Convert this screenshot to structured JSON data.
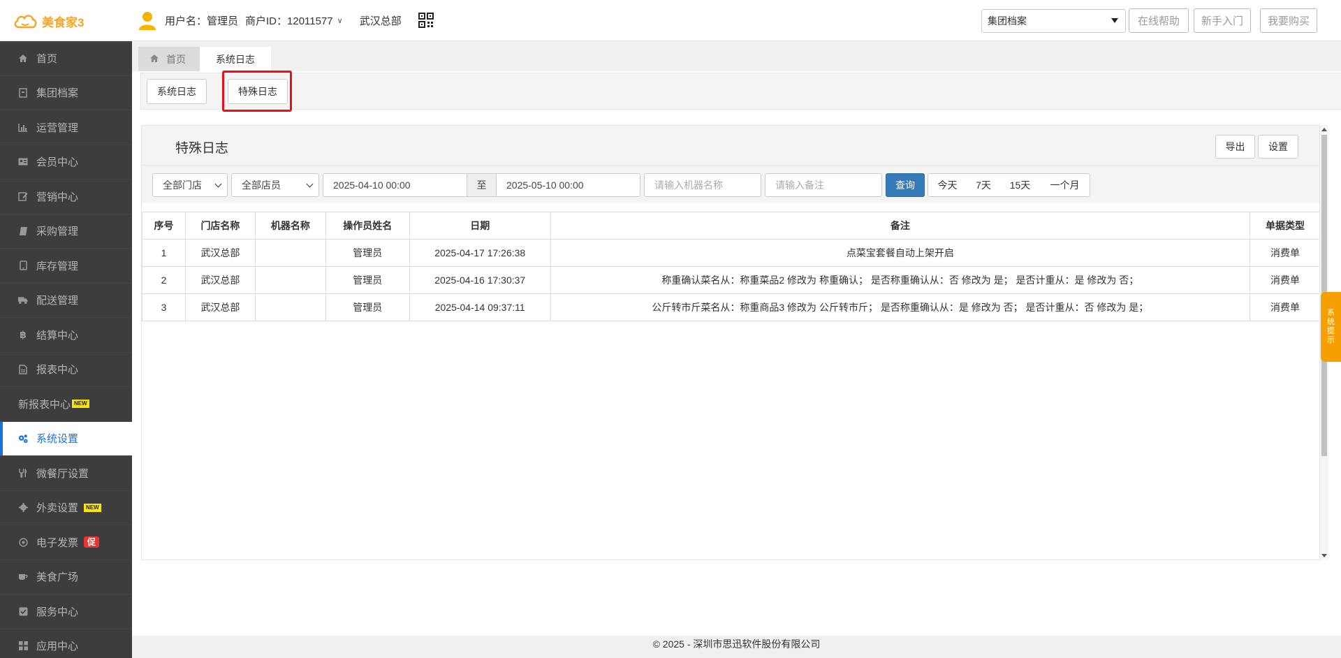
{
  "header": {
    "logo_text": "美食家3",
    "user_label": "用户名：管理员",
    "merchant_id": "商户ID：12011577",
    "store": "武汉总部",
    "group_select": "集团档案",
    "help_button": "在线帮助",
    "newbie_button": "新手入门",
    "buy_button": "我要购买"
  },
  "sidebar": {
    "items": [
      {
        "label": "首页"
      },
      {
        "label": "集团档案"
      },
      {
        "label": "运营管理"
      },
      {
        "label": "会员中心"
      },
      {
        "label": "营销中心"
      },
      {
        "label": "采购管理"
      },
      {
        "label": "库存管理"
      },
      {
        "label": "配送管理"
      },
      {
        "label": "结算中心"
      },
      {
        "label": "报表中心"
      },
      {
        "label": "新报表中心",
        "badge": "NEW"
      },
      {
        "label": "系统设置"
      },
      {
        "label": "微餐厅设置"
      },
      {
        "label": "外卖设置",
        "badge": "NEW"
      },
      {
        "label": "电子发票",
        "badge": "促"
      },
      {
        "label": "美食广场"
      },
      {
        "label": "服务中心"
      },
      {
        "label": "应用中心"
      }
    ]
  },
  "tabs": {
    "home": "首页",
    "current": "系统日志"
  },
  "subtabs": {
    "system_log": "系统日志",
    "special_log": "特殊日志"
  },
  "panel": {
    "title": "特殊日志",
    "export_button": "导出",
    "settings_button": "设置"
  },
  "filters": {
    "store_select": "全部门店",
    "staff_select": "全部店员",
    "date_from": "2025-04-10 00:00",
    "date_sep": "至",
    "date_to": "2025-05-10 00:00",
    "machine_placeholder": "请输入机器名称",
    "remark_placeholder": "请输入备注",
    "query_button": "查询",
    "range_today": "今天",
    "range_7": "7天",
    "range_15": "15天",
    "range_month": "一个月"
  },
  "table": {
    "headers": [
      "序号",
      "门店名称",
      "机器名称",
      "操作员姓名",
      "日期",
      "备注",
      "单据类型"
    ],
    "rows": [
      [
        "1",
        "武汉总部",
        "",
        "管理员",
        "2025-04-17 17:26:38",
        "点菜宝套餐自动上架开启",
        "消费单"
      ],
      [
        "2",
        "武汉总部",
        "",
        "管理员",
        "2025-04-16 17:30:37",
        "称重确认菜名从：称重菜品2 修改为 称重确认； 是否称重确认从：否 修改为 是； 是否计重从：是 修改为 否；",
        "消费单"
      ],
      [
        "3",
        "武汉总部",
        "",
        "管理员",
        "2025-04-14 09:37:11",
        "公斤转市斤菜名从：称重商品3 修改为 公斤转市斤； 是否称重确认从：是 修改为 否； 是否计重从：否 修改为 是；",
        "消费单"
      ]
    ]
  },
  "side_tip": [
    "系",
    "统",
    "提",
    "示"
  ],
  "footer": "© 2025 - 深圳市思迅软件股份有限公司",
  "colors": {
    "sidebar_bg": "#3d3d3d",
    "accent": "#1a73d9",
    "query_button": "#337ab7",
    "logo": "#f5a623",
    "highlight": "#e8111a",
    "tip": "#f5a000"
  }
}
